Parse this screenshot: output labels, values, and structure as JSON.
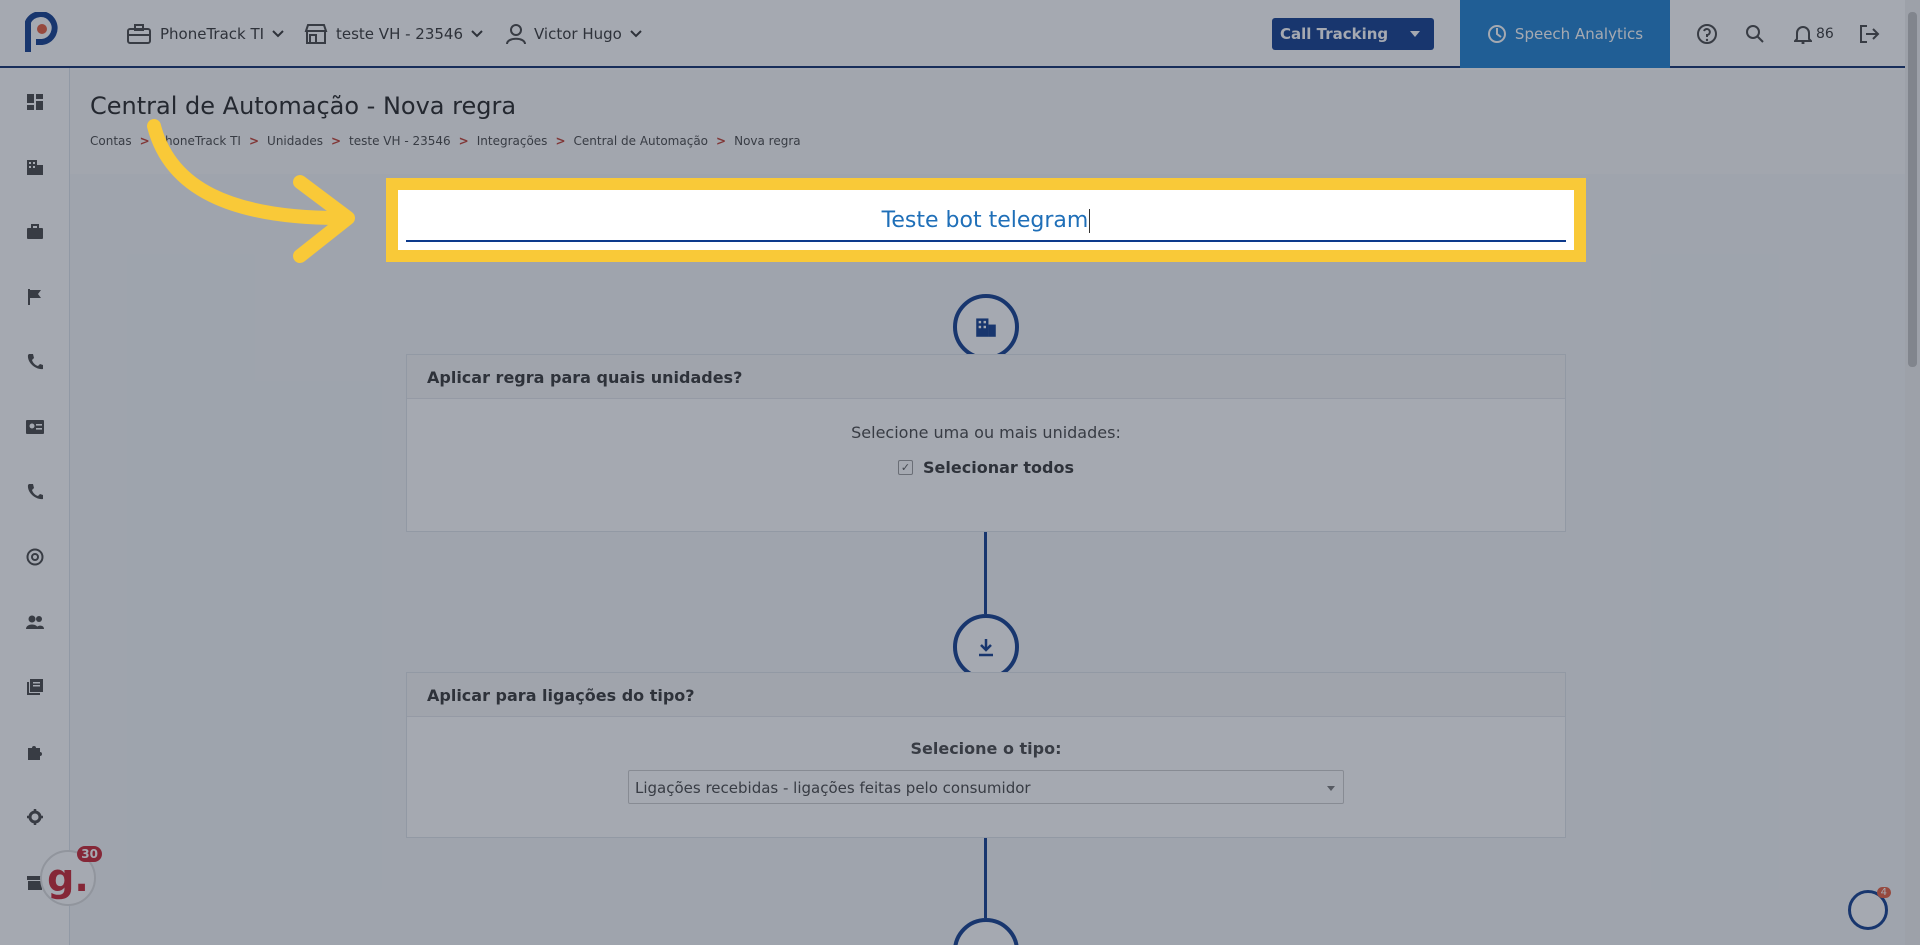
{
  "topbar": {
    "account": "PhoneTrack TI",
    "unit": "teste VH - 23546",
    "user": "Victor Hugo",
    "product_select": "Call Tracking",
    "speech_tab": "Speech Analytics",
    "notifications_count": "86"
  },
  "header": {
    "title": "Central de Automação - Nova regra",
    "breadcrumb": [
      "Contas",
      "PhoneTrack TI",
      "Unidades",
      "teste VH - 23546",
      "Integrações",
      "Central de Automação",
      "Nova regra"
    ],
    "breadcrumb_sep": ">"
  },
  "rule_name": {
    "value": "Teste bot telegram"
  },
  "units_card": {
    "title": "Aplicar regra para quais unidades?",
    "subtitle": "Selecione uma ou mais unidades:",
    "select_all_label": "Selecionar todos",
    "check_mark": "✓"
  },
  "call_type_card": {
    "title": "Aplicar para ligações do tipo?",
    "subtitle": "Selecione o tipo:",
    "selected_option": "Ligações recebidas - ligações feitas pelo consumidor"
  },
  "widgets": {
    "g_badge_letter": "g.",
    "g_badge_count": "30",
    "chat_count": "4"
  },
  "colors": {
    "primary": "#0d3a8c",
    "speech_tab": "#1a7fcf",
    "highlight": "#f9c938"
  }
}
